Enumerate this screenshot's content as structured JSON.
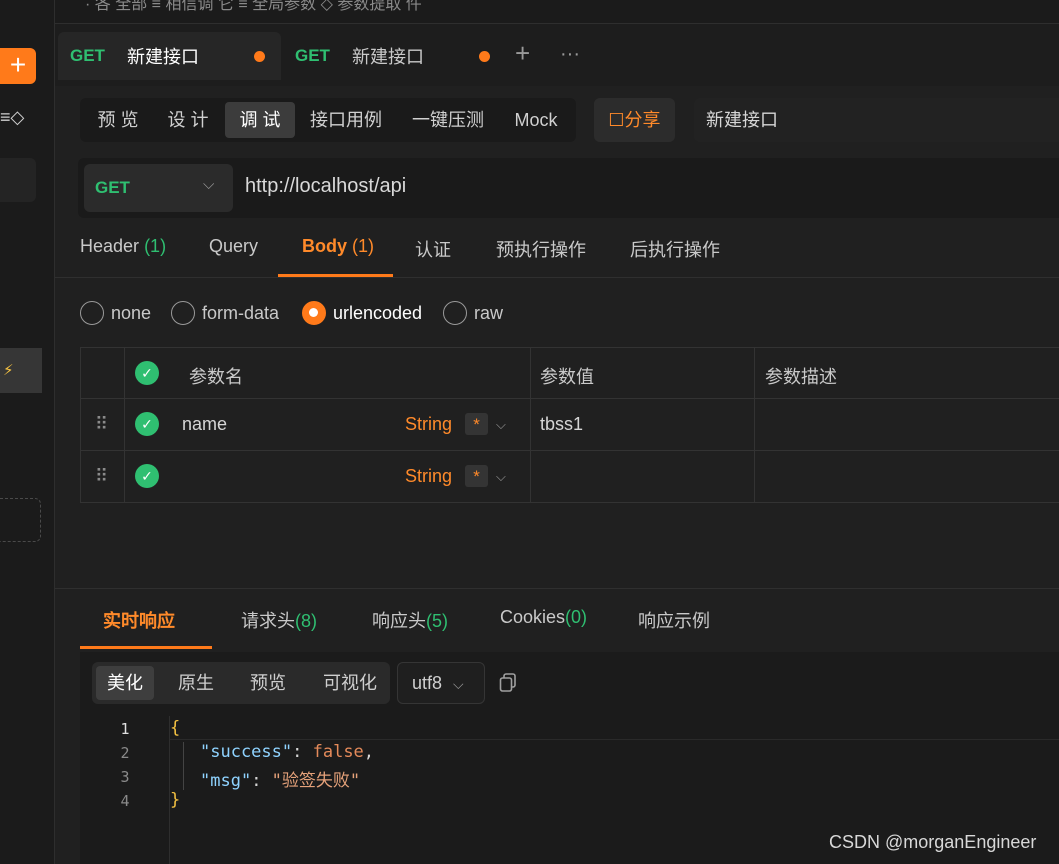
{
  "top_strip": {
    "text": "· 各 全部    ≡ 相信调 它    ≡ 全局参数    ◇ 参数提取 件"
  },
  "tabs": [
    {
      "method": "GET",
      "title": "新建接口",
      "active": true
    },
    {
      "method": "GET",
      "title": "新建接口",
      "active": false
    }
  ],
  "tab_actions": {
    "add": "+",
    "more": "···"
  },
  "sidebar": {
    "plus": "+",
    "glyph": "≡◇",
    "bolt": "⚡"
  },
  "modes": [
    "预 览",
    "设 计",
    "调 试",
    "接口用例",
    "一键压测",
    "Mock"
  ],
  "active_mode": "调 试",
  "share_label": "☐分享",
  "api_name": "新建接口",
  "request": {
    "method": "GET",
    "url": "http://localhost/api"
  },
  "request_tabs": [
    {
      "label": "Header",
      "count": "(1)"
    },
    {
      "label": "Query",
      "count": ""
    },
    {
      "label": "Body",
      "count": "(1)",
      "active": true
    },
    {
      "label": "认证",
      "count": ""
    },
    {
      "label": "预执行操作",
      "count": ""
    },
    {
      "label": "后执行操作",
      "count": ""
    }
  ],
  "body_modes": [
    "none",
    "form-data",
    "urlencoded",
    "raw"
  ],
  "body_mode_selected": "urlencoded",
  "params_table": {
    "headers": [
      "参数名",
      "参数值",
      "参数描述"
    ],
    "rows": [
      {
        "name": "name",
        "type": "String",
        "required": "*",
        "value": "tbss1",
        "description": ""
      },
      {
        "name": "",
        "type": "String",
        "required": "*",
        "value": "",
        "description": ""
      }
    ]
  },
  "response_tabs": [
    {
      "label": "实时响应",
      "count": "",
      "active": true
    },
    {
      "label": "请求头",
      "count": "(8)"
    },
    {
      "label": "响应头",
      "count": "(5)"
    },
    {
      "label": "Cookies",
      "count": "(0)"
    },
    {
      "label": "响应示例",
      "count": ""
    }
  ],
  "format_modes": [
    "美化",
    "原生",
    "预览",
    "可视化"
  ],
  "format_selected": "美化",
  "encoding": "utf8",
  "response_code": {
    "line_numbers": [
      "1",
      "2",
      "3",
      "4"
    ],
    "open_brace": "{",
    "close_brace": "}",
    "success_key": "\"success\"",
    "success_value": "false",
    "msg_key": "\"msg\"",
    "msg_value": "\"验签失败\""
  },
  "watermark": "CSDN @morganEngineer",
  "colors": {
    "accent": "#ff7a1a",
    "method_get": "#2fbf71",
    "background": "#202020"
  }
}
